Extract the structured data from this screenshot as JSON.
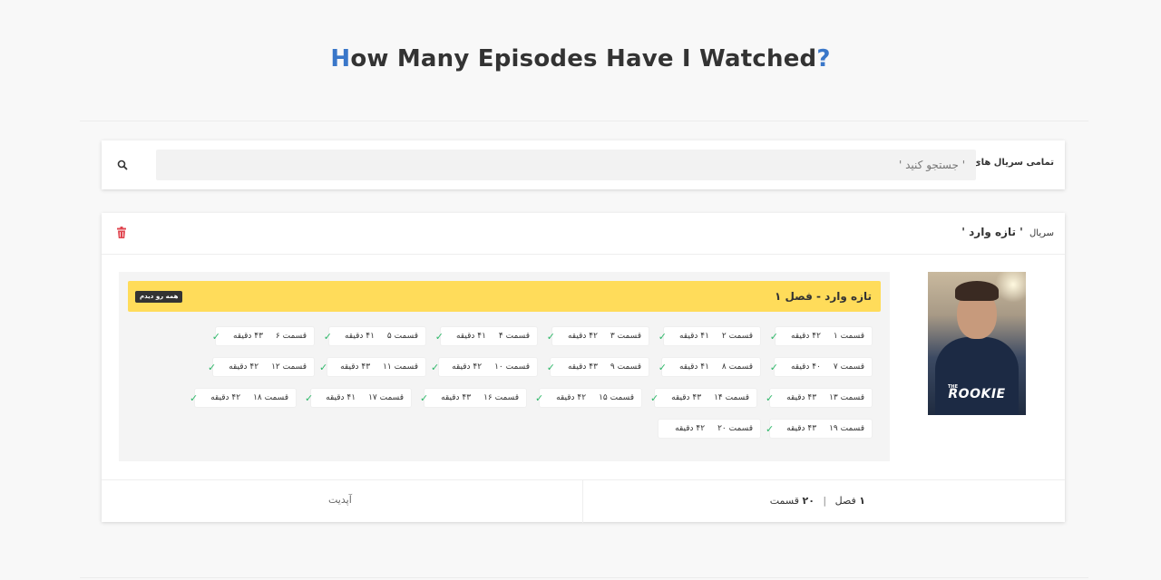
{
  "header": {
    "title_first_letter": "H",
    "title_rest": "ow Many Episodes Have I Watched",
    "title_mark": "?"
  },
  "search": {
    "label": "تمامی سریال های نماوا",
    "placeholder": "' جستجو کنید '"
  },
  "show": {
    "prefix": "سریال",
    "name": "' تازه وارد '",
    "poster_the": "THE",
    "poster_title": "ROOKIE",
    "season": {
      "title": "تازه وارد - فصل ۱",
      "seen_all_label": "همه رو دیدم",
      "episodes": [
        {
          "label": "قسمت ۱",
          "duration": "۴۲ دقیقه",
          "watched": true
        },
        {
          "label": "قسمت ۲",
          "duration": "۴۱ دقیقه",
          "watched": true
        },
        {
          "label": "قسمت ۳",
          "duration": "۴۲ دقیقه",
          "watched": true
        },
        {
          "label": "قسمت ۴",
          "duration": "۴۱ دقیقه",
          "watched": true
        },
        {
          "label": "قسمت ۵",
          "duration": "۴۱ دقیقه",
          "watched": true
        },
        {
          "label": "قسمت ۶",
          "duration": "۴۳ دقیقه",
          "watched": true
        },
        {
          "label": "قسمت ۷",
          "duration": "۴۰ دقیقه",
          "watched": true
        },
        {
          "label": "قسمت ۸",
          "duration": "۴۱ دقیقه",
          "watched": true
        },
        {
          "label": "قسمت ۹",
          "duration": "۴۳ دقیقه",
          "watched": true
        },
        {
          "label": "قسمت ۱۰",
          "duration": "۴۲ دقیقه",
          "watched": true
        },
        {
          "label": "قسمت ۱۱",
          "duration": "۴۳ دقیقه",
          "watched": true
        },
        {
          "label": "قسمت ۱۲",
          "duration": "۴۲ دقیقه",
          "watched": true
        },
        {
          "label": "قسمت ۱۳",
          "duration": "۴۳ دقیقه",
          "watched": true
        },
        {
          "label": "قسمت ۱۴",
          "duration": "۴۳ دقیقه",
          "watched": true
        },
        {
          "label": "قسمت ۱۵",
          "duration": "۴۲ دقیقه",
          "watched": true
        },
        {
          "label": "قسمت ۱۶",
          "duration": "۴۳ دقیقه",
          "watched": true
        },
        {
          "label": "قسمت ۱۷",
          "duration": "۴۱ دقیقه",
          "watched": true
        },
        {
          "label": "قسمت ۱۸",
          "duration": "۴۲ دقیقه",
          "watched": true
        },
        {
          "label": "قسمت ۱۹",
          "duration": "۴۳ دقیقه",
          "watched": true
        },
        {
          "label": "قسمت ۲۰",
          "duration": "۴۲ دقیقه",
          "watched": false
        }
      ]
    }
  },
  "footer": {
    "seasons_count": "۱",
    "seasons_label": "فصل",
    "separator": "|",
    "episodes_count": "۲۰",
    "episodes_label": "قسمت",
    "update_label": "آپدیت"
  },
  "colors": {
    "accent": "#3a77c9",
    "season_header": "#ffdc5a",
    "check": "#2fb86a",
    "trash": "#e0454f",
    "pending": "#3a77c9"
  },
  "icons": {
    "search": "search-icon",
    "trash": "trash-icon",
    "watched": "check-icon",
    "pending": "gear-icon"
  }
}
